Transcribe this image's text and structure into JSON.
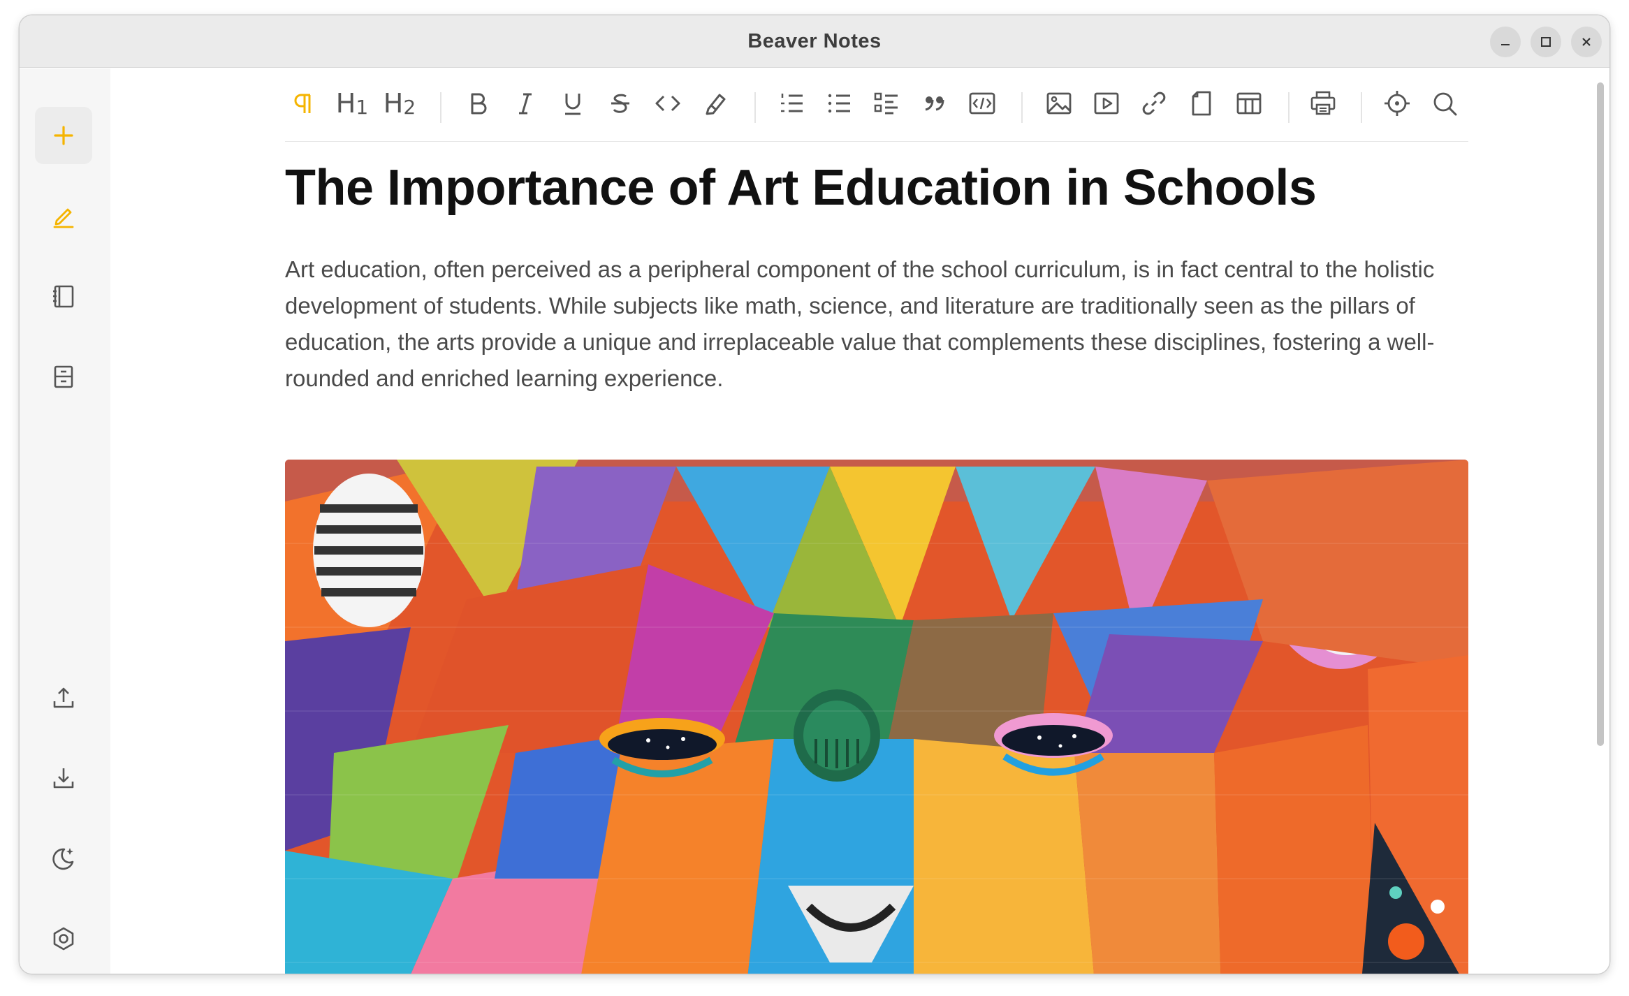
{
  "window": {
    "title": "Beaver Notes"
  },
  "sidebar": {
    "top_items": [
      {
        "name": "new-note",
        "icon": "plus-icon",
        "color": "#f5b400"
      },
      {
        "name": "notes",
        "icon": "pencil-icon",
        "color": "#f5b400"
      },
      {
        "name": "notebooks",
        "icon": "notebook-icon"
      },
      {
        "name": "archive",
        "icon": "archive-icon"
      }
    ],
    "bottom_items": [
      {
        "name": "export",
        "icon": "upload-icon"
      },
      {
        "name": "import",
        "icon": "download-icon"
      },
      {
        "name": "theme",
        "icon": "moon-icon"
      },
      {
        "name": "settings",
        "icon": "settings-icon"
      }
    ]
  },
  "toolbar": {
    "h1": "H",
    "h1_sub": "1",
    "h2": "H",
    "h2_sub": "2",
    "accent_color": "#f5b400",
    "icons": [
      "paragraph-icon",
      "heading1-icon",
      "heading2-icon",
      "bold-icon",
      "italic-icon",
      "underline-icon",
      "strikethrough-icon",
      "code-icon",
      "highlight-icon",
      "ordered-list-icon",
      "bullet-list-icon",
      "task-list-icon",
      "blockquote-icon",
      "code-block-icon",
      "image-icon",
      "video-icon",
      "link-icon",
      "file-icon",
      "table-icon",
      "print-icon",
      "focus-icon",
      "search-icon"
    ]
  },
  "note": {
    "title": "The Importance of Art Education in Schools",
    "paragraph": "Art education, often perceived as a peripheral component of the school curriculum, is in fact central to the holistic development of students. While subjects like math, science, and literature are traditionally seen as the pillars of education, the arts provide a unique and irreplaceable value that complements these disciplines, fostering a well-rounded and enriched learning experience.",
    "image": "colorful geometric bear mural painted on brick wall"
  }
}
